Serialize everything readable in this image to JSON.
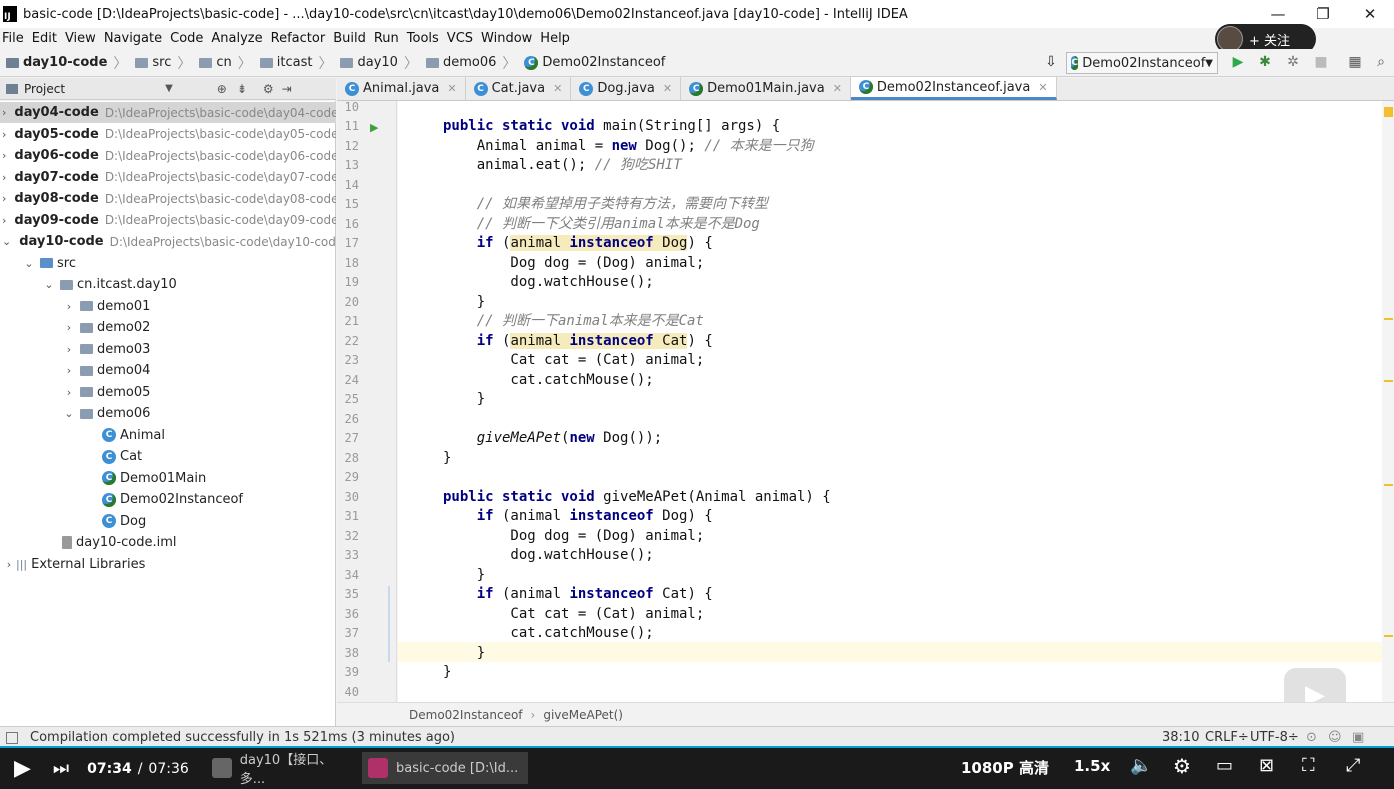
{
  "window": {
    "title": "basic-code [D:\\IdeaProjects\\basic-code] - ...\\day10-code\\src\\cn\\itcast\\day10\\demo06\\Demo02Instanceof.java [day10-code] - IntelliJ IDEA",
    "app_icon_label": "IJ"
  },
  "follow_badge": {
    "label": "+ 关注"
  },
  "menu": [
    "File",
    "Edit",
    "View",
    "Navigate",
    "Code",
    "Analyze",
    "Refactor",
    "Build",
    "Run",
    "Tools",
    "VCS",
    "Window",
    "Help"
  ],
  "navbar": {
    "breadcrumbs": [
      "day10-code",
      "src",
      "cn",
      "itcast",
      "day10",
      "demo06",
      "Demo02Instanceof"
    ],
    "run_config": "Demo02Instanceof"
  },
  "project_panel": {
    "title": "Project",
    "tree": [
      {
        "label": "day04-code",
        "path": "D:\\IdeaProjects\\basic-code\\day04-code",
        "arrow": "›",
        "bold": true,
        "selected": true,
        "indent": 0
      },
      {
        "label": "day05-code",
        "path": "D:\\IdeaProjects\\basic-code\\day05-code",
        "arrow": "›",
        "bold": true,
        "indent": 0
      },
      {
        "label": "day06-code",
        "path": "D:\\IdeaProjects\\basic-code\\day06-code",
        "arrow": "›",
        "bold": true,
        "indent": 0
      },
      {
        "label": "day07-code",
        "path": "D:\\IdeaProjects\\basic-code\\day07-code",
        "arrow": "›",
        "bold": true,
        "indent": 0
      },
      {
        "label": "day08-code",
        "path": "D:\\IdeaProjects\\basic-code\\day08-code",
        "arrow": "›",
        "bold": true,
        "indent": 0
      },
      {
        "label": "day09-code",
        "path": "D:\\IdeaProjects\\basic-code\\day09-code",
        "arrow": "›",
        "bold": true,
        "indent": 0
      },
      {
        "label": "day10-code",
        "path": "D:\\IdeaProjects\\basic-code\\day10-code",
        "arrow": "⌄",
        "bold": true,
        "indent": 0
      },
      {
        "label": "src",
        "arrow": "⌄",
        "indent": 1,
        "icon": "folder"
      },
      {
        "label": "cn.itcast.day10",
        "arrow": "⌄",
        "indent": 2,
        "icon": "package"
      },
      {
        "label": "demo01",
        "arrow": "›",
        "indent": 3,
        "icon": "package"
      },
      {
        "label": "demo02",
        "arrow": "›",
        "indent": 3,
        "icon": "package"
      },
      {
        "label": "demo03",
        "arrow": "›",
        "indent": 3,
        "icon": "package"
      },
      {
        "label": "demo04",
        "arrow": "›",
        "indent": 3,
        "icon": "package"
      },
      {
        "label": "demo05",
        "arrow": "›",
        "indent": 3,
        "icon": "package"
      },
      {
        "label": "demo06",
        "arrow": "⌄",
        "indent": 3,
        "icon": "package"
      },
      {
        "label": "Animal",
        "indent": 4,
        "icon": "class"
      },
      {
        "label": "Cat",
        "indent": 4,
        "icon": "class"
      },
      {
        "label": "Demo01Main",
        "indent": 4,
        "icon": "main-class"
      },
      {
        "label": "Demo02Instanceof",
        "indent": 4,
        "icon": "main-class"
      },
      {
        "label": "Dog",
        "indent": 4,
        "icon": "class"
      },
      {
        "label": "day10-code.iml",
        "indent": 2,
        "icon": "file"
      },
      {
        "label": "External Libraries",
        "arrow": "›",
        "indent": 0,
        "icon": "library"
      }
    ]
  },
  "tabs": [
    {
      "label": "Animal.java",
      "active": false
    },
    {
      "label": "Cat.java",
      "active": false
    },
    {
      "label": "Dog.java",
      "active": false
    },
    {
      "label": "Demo01Main.java",
      "active": false
    },
    {
      "label": "Demo02Instanceof.java",
      "active": true
    }
  ],
  "editor": {
    "first_line": 10,
    "code_lines": [
      {
        "n": "10",
        "html": ""
      },
      {
        "n": "11",
        "html": "<span class=\"kw\">public static void</span> main(String[] args) {"
      },
      {
        "n": "12",
        "html": "    Animal animal = <span class=\"kw\">new</span> Dog(); <span class=\"cm\">// 本来是一只狗</span>"
      },
      {
        "n": "13",
        "html": "    animal.eat(); <span class=\"cm\">// 狗吃SHIT</span>"
      },
      {
        "n": "14",
        "html": ""
      },
      {
        "n": "15",
        "html": "    <span class=\"cm\">// 如果希望掉用子类特有方法，需要向下转型</span>"
      },
      {
        "n": "16",
        "html": "    <span class=\"cm\">// 判断一下父类引用animal本来是不是Dog</span>"
      },
      {
        "n": "17",
        "html": "    <span class=\"kw\">if</span> (<span class=\"hl\">animal <span class=\"kw\">instanceof</span> Dog</span>) {"
      },
      {
        "n": "18",
        "html": "        Dog dog = (Dog) animal;"
      },
      {
        "n": "19",
        "html": "        dog.watchHouse();"
      },
      {
        "n": "20",
        "html": "    }"
      },
      {
        "n": "21",
        "html": "    <span class=\"cm\">// 判断一下animal本来是不是Cat</span>"
      },
      {
        "n": "22",
        "html": "    <span class=\"kw\">if</span> (<span class=\"hl\">animal <span class=\"kw\">instanceof</span> Cat</span>) {"
      },
      {
        "n": "23",
        "html": "        Cat cat = (Cat) animal;"
      },
      {
        "n": "24",
        "html": "        cat.catchMouse();"
      },
      {
        "n": "25",
        "html": "    }"
      },
      {
        "n": "26",
        "html": ""
      },
      {
        "n": "27",
        "html": "    <span class=\"it\">giveMeAPet</span>(<span class=\"kw\">new</span> Dog());"
      },
      {
        "n": "28",
        "html": "}"
      },
      {
        "n": "29",
        "html": ""
      },
      {
        "n": "30",
        "html": "<span class=\"kw\">public static void</span> giveMeAPet(Animal animal) {"
      },
      {
        "n": "31",
        "html": "    <span class=\"kw\">if</span> (animal <span class=\"kw\">instanceof</span> Dog) {"
      },
      {
        "n": "32",
        "html": "        Dog dog = (Dog) animal;"
      },
      {
        "n": "33",
        "html": "        dog.watchHouse();"
      },
      {
        "n": "34",
        "html": "    }"
      },
      {
        "n": "35",
        "html": "    <span class=\"kw\">if</span> (animal <span class=\"kw\">instanceof</span> Cat) {"
      },
      {
        "n": "36",
        "html": "        Cat cat = (Cat) animal;"
      },
      {
        "n": "37",
        "html": "        cat.catchMouse();"
      },
      {
        "n": "38",
        "html": "    }"
      },
      {
        "n": "39",
        "html": "}"
      },
      {
        "n": "40",
        "html": ""
      }
    ]
  },
  "editor_breadcrumb": [
    "Demo02Instanceof",
    "giveMeAPet()"
  ],
  "status": {
    "message": "Compilation completed successfully in 1s 521ms (3 minutes ago)",
    "position": "38:10",
    "line_sep": "CRLF÷",
    "encoding": "UTF-8÷"
  },
  "video": {
    "current_time": "07:34",
    "total_time": "07:36",
    "quality": "1080P 高清",
    "speed": "1.5x",
    "tasks": [
      {
        "label": "day10【接口、多...",
        "active": false
      },
      {
        "label": "basic-code [D:\\Id...",
        "active": true
      }
    ]
  }
}
